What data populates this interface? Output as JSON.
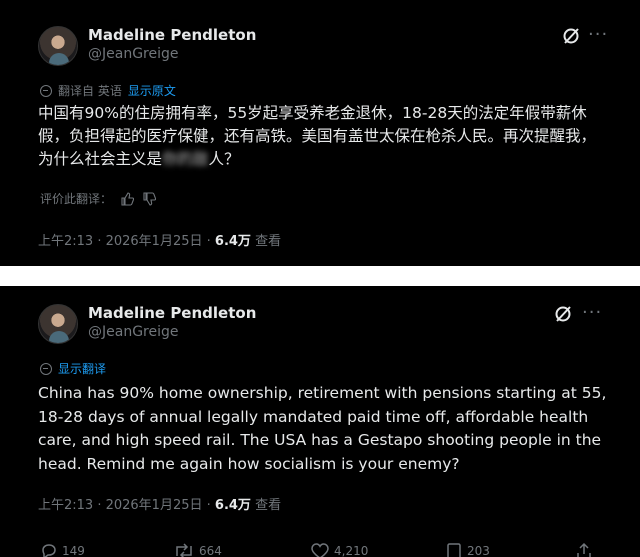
{
  "top_tweet": {
    "author_name": "Madeline Pendleton",
    "author_handle": "@JeanGreige",
    "translated_from": "翻译自 英语",
    "show_original": "显示原文",
    "text_before_blur": "中国有90%的住房拥有率，55岁起享受养老金退休，18-28天的法定年假带薪休假，负担得起的医疗保健，还有高铁。美国有盖世太保在枪杀人民。再次提醒我，为什么社会主义是",
    "text_blurred": "你的敌",
    "text_after_blur": "人？",
    "rate_translation": "评价此翻译：",
    "time": "上午2:13 · 2026年1月25日 ·",
    "views_count": "6.4万",
    "views_label": "查看"
  },
  "bottom_tweet": {
    "author_name": "Madeline Pendleton",
    "author_handle": "@JeanGreige",
    "show_translation": "显示翻译",
    "text": "China has 90% home ownership, retirement with pensions starting at 55, 18-28 days of annual legally mandated paid time off, affordable health care, and high speed rail. The USA has a Gestapo shooting people in the head. Remind me again how socialism is your enemy?",
    "time": "上午2:13 · 2026年1月25日 ·",
    "views_count": "6.4万",
    "views_label": "查看"
  },
  "actions": {
    "replies": "149",
    "reposts": "664",
    "likes": "4,210",
    "bookmarks": "203"
  },
  "icons": {
    "grok": "grok-icon",
    "more": "more-icon",
    "translate": "translate-icon",
    "thumbs_up": "thumbs-up-icon",
    "thumbs_down": "thumbs-down-icon",
    "reply": "reply-icon",
    "repost": "repost-icon",
    "like": "heart-icon",
    "bookmark": "bookmark-icon",
    "share": "share-icon"
  },
  "colors": {
    "background": "#000000",
    "text": "#e7e9ea",
    "muted": "#71767b",
    "link": "#1d9bf0",
    "divider": "#ffffff"
  }
}
